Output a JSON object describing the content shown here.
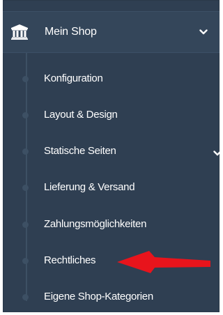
{
  "sidebar": {
    "shop": {
      "label": "Mein Shop",
      "icon": "bank-icon",
      "expanded": true
    },
    "items": [
      {
        "label": "Konfiguration"
      },
      {
        "label": "Layout & Design"
      },
      {
        "label": "Statische Seiten",
        "has_submenu": true
      },
      {
        "label": "Lieferung & Versand"
      },
      {
        "label": "Zahlungsmöglichkeiten"
      },
      {
        "label": "Rechtliches",
        "highlighted": true
      },
      {
        "label": "Eigene Shop-Kategorien"
      }
    ]
  },
  "annotation": {
    "type": "arrow",
    "color": "#e8141c",
    "points_to": "Rechtliches"
  },
  "colors": {
    "panel_bg": "#2f3f52",
    "header_bg": "#34465a",
    "text": "#ffffff",
    "tree_line": "#3d5064"
  }
}
